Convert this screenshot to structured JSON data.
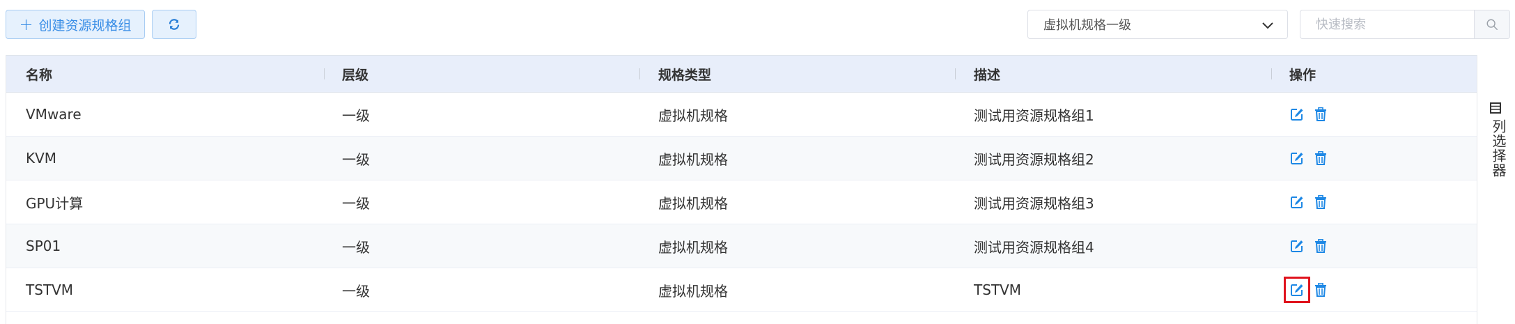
{
  "toolbar": {
    "create_label": "创建资源规格组",
    "select_value": "虚拟机规格一级",
    "search_placeholder": "快速搜索"
  },
  "table": {
    "headers": [
      "名称",
      "层级",
      "规格类型",
      "描述",
      "操作"
    ],
    "rows": [
      {
        "name": "VMware",
        "level": "一级",
        "type": "虚拟机规格",
        "desc": "测试用资源规格组1"
      },
      {
        "name": "KVM",
        "level": "一级",
        "type": "虚拟机规格",
        "desc": "测试用资源规格组2"
      },
      {
        "name": "GPU计算",
        "level": "一级",
        "type": "虚拟机规格",
        "desc": "测试用资源规格组3"
      },
      {
        "name": "SP01",
        "level": "一级",
        "type": "虚拟机规格",
        "desc": "测试用资源规格组4"
      },
      {
        "name": "TSTVM",
        "level": "一级",
        "type": "虚拟机规格",
        "desc": "TSTVM"
      }
    ]
  },
  "column_selector": {
    "label": "列选择器"
  },
  "colors": {
    "accent": "#1e88e5",
    "highlight": "#e0141e",
    "header_bg": "#e8eefa"
  },
  "icons": {
    "create": "plus-icon",
    "refresh": "refresh-icon",
    "dropdown": "chevron-down-icon",
    "search": "search-icon",
    "edit": "edit-icon",
    "delete": "trash-icon",
    "columns": "columns-icon"
  }
}
